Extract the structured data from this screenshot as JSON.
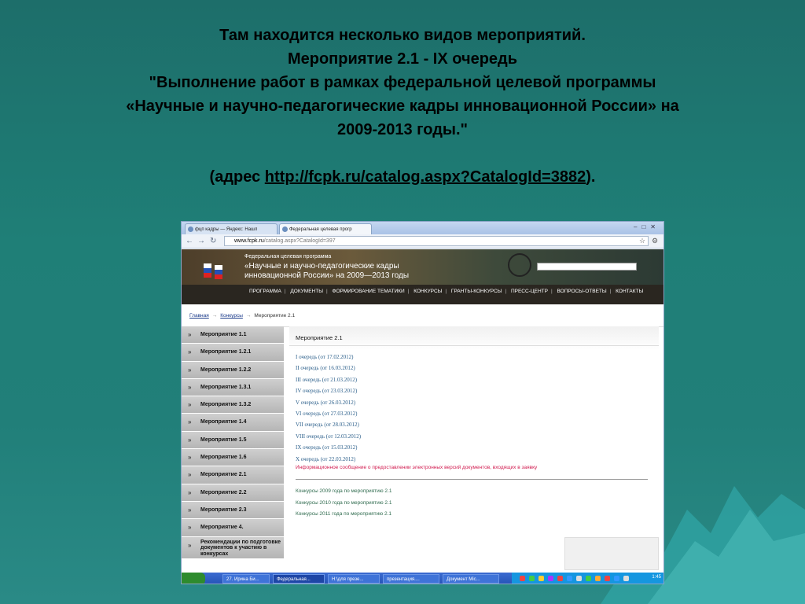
{
  "slide": {
    "line1": "Там находится несколько видов мероприятий.",
    "line2": "Мероприятие 2.1 - IX очередь",
    "line3": "\"Выполнение работ в рамках федеральной целевой программы",
    "line4": "«Научные и научно-педагогические кадры инновационной России» на",
    "line5": "2009-2013 годы.\"",
    "addr_prefix": "(адрес ",
    "addr_link": "http://fcpk.ru/catalog.aspx?CatalogId=3882",
    "addr_suffix": ")."
  },
  "browser": {
    "tabs": [
      "фцп кадры — Яндекс: Нашл",
      "Федеральная целевая прогр"
    ],
    "url_domain": "www.fcpk.ru",
    "url_path": "/catalog.aspx?CatalogId=397"
  },
  "site": {
    "hdr_line1": "Федеральная целевая программа",
    "hdr_line2": "«Научные и научно-педагогические кадры",
    "hdr_line3": "инновационной России» на 2009—2013 годы",
    "menu": [
      "Программа",
      "Документы",
      "Формирование тематики",
      "Конкурсы",
      "Гранты-конкурсы",
      "Пресс-центр",
      "Вопросы-ответы",
      "Контакты"
    ]
  },
  "breadcrumb": {
    "home": "Главная",
    "konkursy": "Конкурсы",
    "current": "Мероприятие 2.1"
  },
  "sidebar": {
    "items": [
      "Мероприятие 1.1",
      "Мероприятие 1.2.1",
      "Мероприятие 1.2.2",
      "Мероприятие 1.3.1",
      "Мероприятие 1.3.2",
      "Мероприятие 1.4",
      "Мероприятие 1.5",
      "Мероприятие 1.6",
      "Мероприятие 2.1",
      "Мероприятие 2.2",
      "Мероприятие 2.3",
      "Мероприятие 4.",
      "Рекомендации по подготовке документов к участию в конкурсах"
    ]
  },
  "main": {
    "title": "Мероприятие 2.1",
    "queues": [
      "I очередь (от 17.02.2012)",
      "II очередь (от 16.03.2012)",
      "III очередь (от 21.03.2012)",
      "IV очередь (от 23.03.2012)",
      "V очередь (от 26.03.2012)",
      "VI очередь (от 27.03.2012)",
      "VII очередь (от 28.03.2012)",
      "VIII очередь (от 12.03.2012)",
      "IX очередь (от 15.03.2012)",
      "X очередь (от 22.03.2012)"
    ],
    "info": "Информационное сообщение о предоставлении электронных версий документов, входящих в заявку",
    "konkursy": [
      "Конкурсы 2009 года по мероприятию 2.1",
      "Конкурсы 2010 года по мероприятию 2.1",
      "Конкурсы 2011 года по мероприятию 2.1"
    ]
  },
  "taskbar": {
    "items": [
      "27. Ирина Би...",
      "Федеральная...",
      "Н:\\для презе...",
      "презентация....",
      "Документ Mic..."
    ],
    "clock": "1:45"
  }
}
